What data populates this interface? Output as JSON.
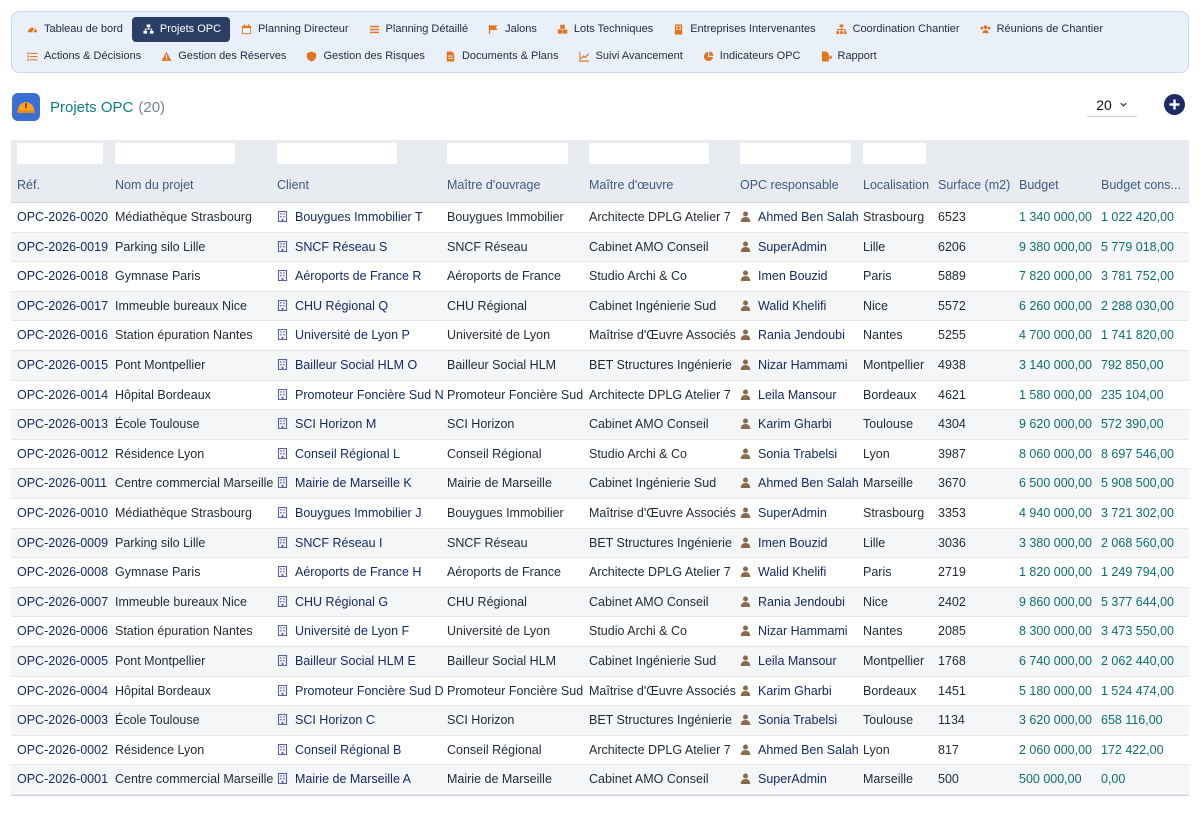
{
  "menu": {
    "row1": [
      {
        "label": "Tableau de bord",
        "icon": "dashboard-icon",
        "color": "#e0751e",
        "active": false
      },
      {
        "label": "Projets OPC",
        "icon": "sitemap-icon",
        "color": "#ffffff",
        "active": true
      },
      {
        "label": "Planning Directeur",
        "icon": "calendar-icon",
        "color": "#e0751e",
        "active": false
      },
      {
        "label": "Planning Détaillé",
        "icon": "bars-icon",
        "color": "#e0751e",
        "active": false
      },
      {
        "label": "Jalons",
        "icon": "flag-icon",
        "color": "#e0751e",
        "active": false
      },
      {
        "label": "Lots Techniques",
        "icon": "cubes-icon",
        "color": "#e0751e",
        "active": false
      },
      {
        "label": "Entreprises Intervenantes",
        "icon": "building-icon",
        "color": "#e0751e",
        "active": false
      },
      {
        "label": "Coordination Chantier",
        "icon": "network-icon",
        "color": "#e0751e",
        "active": false
      },
      {
        "label": "Réunions de Chantier",
        "icon": "users-icon",
        "color": "#e0751e",
        "active": false
      }
    ],
    "row2": [
      {
        "label": "Actions & Décisions",
        "icon": "list-icon",
        "color": "#e0751e",
        "active": false
      },
      {
        "label": "Gestion des Réserves",
        "icon": "warning-icon",
        "color": "#e0751e",
        "active": false
      },
      {
        "label": "Gestion des Risques",
        "icon": "shield-icon",
        "color": "#e0751e",
        "active": false
      },
      {
        "label": "Documents & Plans",
        "icon": "file-icon",
        "color": "#e0751e",
        "active": false
      },
      {
        "label": "Suivi Avancement",
        "icon": "line-chart-icon",
        "color": "#e0751e",
        "active": false
      },
      {
        "label": "Indicateurs OPC",
        "icon": "pie-chart-icon",
        "color": "#e0751e",
        "active": false
      },
      {
        "label": "Rapport",
        "icon": "file-export-icon",
        "color": "#e0751e",
        "active": false
      }
    ]
  },
  "header": {
    "title": "Projets OPC",
    "count": "(20)",
    "page_size": "20",
    "app_icon": "hard-hat-icon",
    "add_icon": "plus-circle-icon"
  },
  "colors": {
    "accent": "#2a3f63",
    "menu_icon": "#e0751e",
    "title": "#0b7e84",
    "link": "#142a63",
    "number": "#0d6e70",
    "user_icon": "#8a6a4a",
    "client_icon": "#5a5fa8"
  },
  "table": {
    "columns": [
      "Réf.",
      "Nom du projet",
      "Client",
      "Maître d'ouvrage",
      "Maître d'œuvre",
      "OPC responsable",
      "Localisation",
      "Surface (m2)",
      "Budget",
      "Budget cons..."
    ],
    "rows": [
      [
        "OPC-2026-0020",
        "Médiathèque Strasbourg",
        "Bouygues Immobilier T",
        "Bouygues Immobilier",
        "Architecte DPLG Atelier 7",
        "Ahmed Ben Salah",
        "Strasbourg",
        "6523",
        "1 340 000,00",
        "1 022 420,00"
      ],
      [
        "OPC-2026-0019",
        "Parking silo Lille",
        "SNCF Réseau S",
        "SNCF Réseau",
        "Cabinet AMO Conseil",
        "SuperAdmin",
        "Lille",
        "6206",
        "9 380 000,00",
        "5 779 018,00"
      ],
      [
        "OPC-2026-0018",
        "Gymnase Paris",
        "Aéroports de France R",
        "Aéroports de France",
        "Studio Archi & Co",
        "Imen Bouzid",
        "Paris",
        "5889",
        "7 820 000,00",
        "3 781 752,00"
      ],
      [
        "OPC-2026-0017",
        "Immeuble bureaux Nice",
        "CHU Régional Q",
        "CHU Régional",
        "Cabinet Ingénierie Sud",
        "Walid Khelifi",
        "Nice",
        "5572",
        "6 260 000,00",
        "2 288 030,00"
      ],
      [
        "OPC-2026-0016",
        "Station épuration Nantes",
        "Université de Lyon P",
        "Université de Lyon",
        "Maîtrise d'Œuvre Associés",
        "Rania Jendoubi",
        "Nantes",
        "5255",
        "4 700 000,00",
        "1 741 820,00"
      ],
      [
        "OPC-2026-0015",
        "Pont Montpellier",
        "Bailleur Social HLM O",
        "Bailleur Social HLM",
        "BET Structures Ingénierie",
        "Nizar Hammami",
        "Montpellier",
        "4938",
        "3 140 000,00",
        "792 850,00"
      ],
      [
        "OPC-2026-0014",
        "Hôpital Bordeaux",
        "Promoteur Foncière Sud N",
        "Promoteur Foncière Sud",
        "Architecte DPLG Atelier 7",
        "Leila Mansour",
        "Bordeaux",
        "4621",
        "1 580 000,00",
        "235 104,00"
      ],
      [
        "OPC-2026-0013",
        "École Toulouse",
        "SCI Horizon M",
        "SCI Horizon",
        "Cabinet AMO Conseil",
        "Karim Gharbi",
        "Toulouse",
        "4304",
        "9 620 000,00",
        "572 390,00"
      ],
      [
        "OPC-2026-0012",
        "Résidence Lyon",
        "Conseil Régional L",
        "Conseil Régional",
        "Studio Archi & Co",
        "Sonia Trabelsi",
        "Lyon",
        "3987",
        "8 060 000,00",
        "8 697 546,00"
      ],
      [
        "OPC-2026-0011",
        "Centre commercial Marseille",
        "Mairie de Marseille K",
        "Mairie de Marseille",
        "Cabinet Ingénierie Sud",
        "Ahmed Ben Salah",
        "Marseille",
        "3670",
        "6 500 000,00",
        "5 908 500,00"
      ],
      [
        "OPC-2026-0010",
        "Médiathèque Strasbourg",
        "Bouygues Immobilier J",
        "Bouygues Immobilier",
        "Maîtrise d'Œuvre Associés",
        "SuperAdmin",
        "Strasbourg",
        "3353",
        "4 940 000,00",
        "3 721 302,00"
      ],
      [
        "OPC-2026-0009",
        "Parking silo Lille",
        "SNCF Réseau I",
        "SNCF Réseau",
        "BET Structures Ingénierie",
        "Imen Bouzid",
        "Lille",
        "3036",
        "3 380 000,00",
        "2 068 560,00"
      ],
      [
        "OPC-2026-0008",
        "Gymnase Paris",
        "Aéroports de France H",
        "Aéroports de France",
        "Architecte DPLG Atelier 7",
        "Walid Khelifi",
        "Paris",
        "2719",
        "1 820 000,00",
        "1 249 794,00"
      ],
      [
        "OPC-2026-0007",
        "Immeuble bureaux Nice",
        "CHU Régional G",
        "CHU Régional",
        "Cabinet AMO Conseil",
        "Rania Jendoubi",
        "Nice",
        "2402",
        "9 860 000,00",
        "5 377 644,00"
      ],
      [
        "OPC-2026-0006",
        "Station épuration Nantes",
        "Université de Lyon F",
        "Université de Lyon",
        "Studio Archi & Co",
        "Nizar Hammami",
        "Nantes",
        "2085",
        "8 300 000,00",
        "3 473 550,00"
      ],
      [
        "OPC-2026-0005",
        "Pont Montpellier",
        "Bailleur Social HLM E",
        "Bailleur Social HLM",
        "Cabinet Ingénierie Sud",
        "Leila Mansour",
        "Montpellier",
        "1768",
        "6 740 000,00",
        "2 062 440,00"
      ],
      [
        "OPC-2026-0004",
        "Hôpital Bordeaux",
        "Promoteur Foncière Sud D",
        "Promoteur Foncière Sud",
        "Maîtrise d'Œuvre Associés",
        "Karim Gharbi",
        "Bordeaux",
        "1451",
        "5 180 000,00",
        "1 524 474,00"
      ],
      [
        "OPC-2026-0003",
        "École Toulouse",
        "SCI Horizon C",
        "SCI Horizon",
        "BET Structures Ingénierie",
        "Sonia Trabelsi",
        "Toulouse",
        "1134",
        "3 620 000,00",
        "658 116,00"
      ],
      [
        "OPC-2026-0002",
        "Résidence Lyon",
        "Conseil Régional B",
        "Conseil Régional",
        "Architecte DPLG Atelier 7",
        "Ahmed Ben Salah",
        "Lyon",
        "817",
        "2 060 000,00",
        "172 422,00"
      ],
      [
        "OPC-2026-0001",
        "Centre commercial Marseille",
        "Mairie de Marseille A",
        "Mairie de Marseille",
        "Cabinet AMO Conseil",
        "SuperAdmin",
        "Marseille",
        "500",
        "500 000,00",
        "0,00"
      ]
    ]
  }
}
